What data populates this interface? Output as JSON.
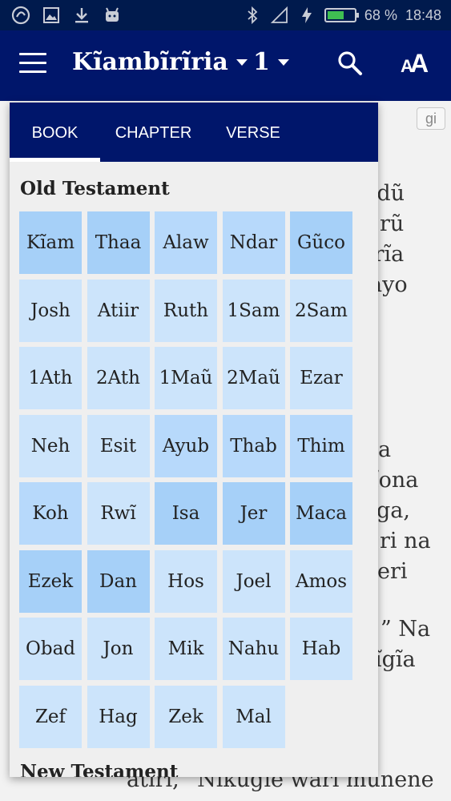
{
  "status_bar": {
    "battery_percent": "68 %",
    "battery_level": 0.68,
    "battery_color": "#3fbf52",
    "time": "18:48",
    "left_icons": [
      "app-notification-icon",
      "image-icon",
      "download-icon",
      "android-icon"
    ],
    "right_icons": [
      "bluetooth-icon",
      "signal-icon",
      "charging-icon"
    ]
  },
  "app_bar": {
    "book": "Kĩambĩrĩria",
    "chapter": "1",
    "background": "#00166b"
  },
  "reading": {
    "language_badge": "gi",
    "lines": [
      "ndũ",
      "rũ",
      "ĩrĩa",
      "ayo",
      "a",
      "ĩona",
      "ga,",
      "ri na",
      "eri",
      "” Na",
      "ĩgĩa",
      "atiri, “Nikũgĩe warĩ munene"
    ]
  },
  "picker": {
    "tabs": [
      "BOOK",
      "CHAPTER",
      "VERSE"
    ],
    "active_tab": "BOOK",
    "old_testament_title": "Old Testament",
    "new_testament_title": "New Testament",
    "books": [
      {
        "label": "Kĩam",
        "tone": "dark"
      },
      {
        "label": "Thaa",
        "tone": "dark"
      },
      {
        "label": "Alaw",
        "tone": "mid"
      },
      {
        "label": "Ndar",
        "tone": "mid"
      },
      {
        "label": "Gũco",
        "tone": "dark"
      },
      {
        "label": "Josh",
        "tone": "light"
      },
      {
        "label": "Atiir",
        "tone": "light"
      },
      {
        "label": "Ruth",
        "tone": "light"
      },
      {
        "label": "1Sam",
        "tone": "light"
      },
      {
        "label": "2Sam",
        "tone": "light"
      },
      {
        "label": "1Ath",
        "tone": "light"
      },
      {
        "label": "2Ath",
        "tone": "light"
      },
      {
        "label": "1Maũ",
        "tone": "light"
      },
      {
        "label": "2Maũ",
        "tone": "light"
      },
      {
        "label": "Ezar",
        "tone": "light"
      },
      {
        "label": "Neh",
        "tone": "light"
      },
      {
        "label": "Esit",
        "tone": "light"
      },
      {
        "label": "Ayub",
        "tone": "mid"
      },
      {
        "label": "Thab",
        "tone": "mid"
      },
      {
        "label": "Thim",
        "tone": "mid"
      },
      {
        "label": "Koh",
        "tone": "mid"
      },
      {
        "label": "Rwĩ",
        "tone": "light"
      },
      {
        "label": "Isa",
        "tone": "dark"
      },
      {
        "label": "Jer",
        "tone": "dark"
      },
      {
        "label": "Maca",
        "tone": "dark"
      },
      {
        "label": "Ezek",
        "tone": "dark"
      },
      {
        "label": "Dan",
        "tone": "dark"
      },
      {
        "label": "Hos",
        "tone": "light"
      },
      {
        "label": "Joel",
        "tone": "light"
      },
      {
        "label": "Amos",
        "tone": "light"
      },
      {
        "label": "Obad",
        "tone": "light"
      },
      {
        "label": "Jon",
        "tone": "light"
      },
      {
        "label": "Mik",
        "tone": "light"
      },
      {
        "label": "Nahu",
        "tone": "light"
      },
      {
        "label": "Hab",
        "tone": "light"
      },
      {
        "label": "Zef",
        "tone": "light"
      },
      {
        "label": "Hag",
        "tone": "light"
      },
      {
        "label": "Zek",
        "tone": "light"
      },
      {
        "label": "Mal",
        "tone": "light"
      }
    ]
  }
}
